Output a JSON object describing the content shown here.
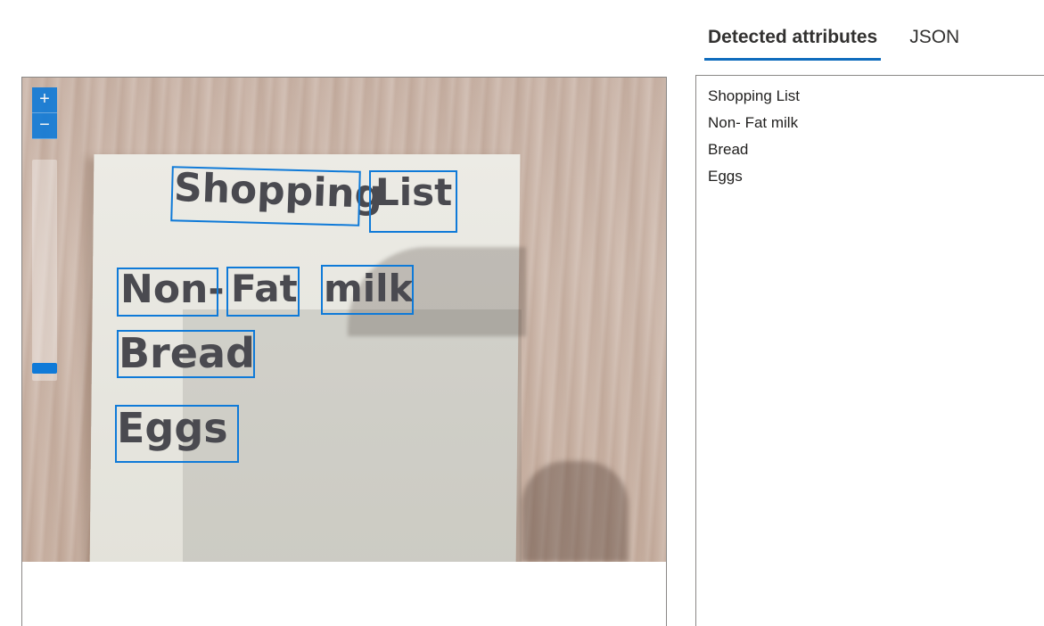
{
  "tabs": [
    {
      "label": "Detected attributes",
      "active": true
    },
    {
      "label": "JSON",
      "active": false
    }
  ],
  "viewer": {
    "zoom_in_icon": "+",
    "zoom_out_icon": "−",
    "handwriting": {
      "word1": "Shopping",
      "word2": "List",
      "word3": "Non-",
      "word4": "Fat",
      "word5": "milk",
      "word6": "Bread",
      "word7": "Eggs"
    }
  },
  "results": {
    "lines": [
      "Shopping List",
      "Non- Fat milk",
      "Bread",
      "Eggs"
    ]
  },
  "colors": {
    "accent": "#0f7ad8",
    "tab_underline": "#0f6cbd",
    "text": "#201f1e"
  }
}
